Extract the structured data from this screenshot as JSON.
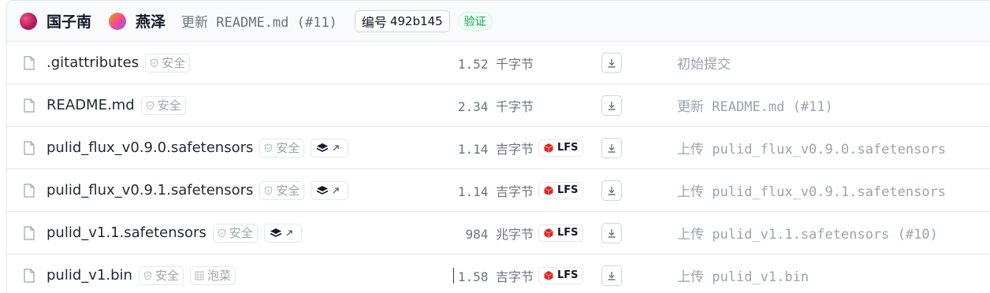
{
  "header": {
    "author1": "国子南",
    "author2": "燕泽",
    "commit_message": "更新 README.md (#11)",
    "commit_label": "编号",
    "commit_hash": "492b145",
    "verified": "验证"
  },
  "badges": {
    "safe": "安全",
    "pickle": "泡菜",
    "lfs": "LFS"
  },
  "files": [
    {
      "name": ".gitattributes",
      "size": "1.52 千字节",
      "lfs": false,
      "xet": false,
      "pickle": false,
      "message": "初始提交"
    },
    {
      "name": "README.md",
      "size": "2.34 千字节",
      "lfs": false,
      "xet": false,
      "pickle": false,
      "message": "更新 README.md (#11)"
    },
    {
      "name": "pulid_flux_v0.9.0.safetensors",
      "size": "1.14 吉字节",
      "lfs": true,
      "xet": true,
      "pickle": false,
      "message": "上传 pulid_flux_v0.9.0.safetensors"
    },
    {
      "name": "pulid_flux_v0.9.1.safetensors",
      "size": "1.14 吉字节",
      "lfs": true,
      "xet": true,
      "pickle": false,
      "message": "上传 pulid_flux_v0.9.1.safetensors"
    },
    {
      "name": "pulid_v1.1.safetensors",
      "size": "984 兆字节",
      "lfs": true,
      "xet": true,
      "pickle": false,
      "message": "上传 pulid_v1.1.safetensors (#10)"
    },
    {
      "name": "pulid_v1.bin",
      "size": "1.58 吉字节",
      "lfs": true,
      "xet": false,
      "pickle": true,
      "message": "上传 pulid_v1.bin"
    }
  ],
  "colors": {
    "verified_text": "#16a34a",
    "lfs_icon": "#dc2626",
    "muted": "#9ca3af"
  }
}
